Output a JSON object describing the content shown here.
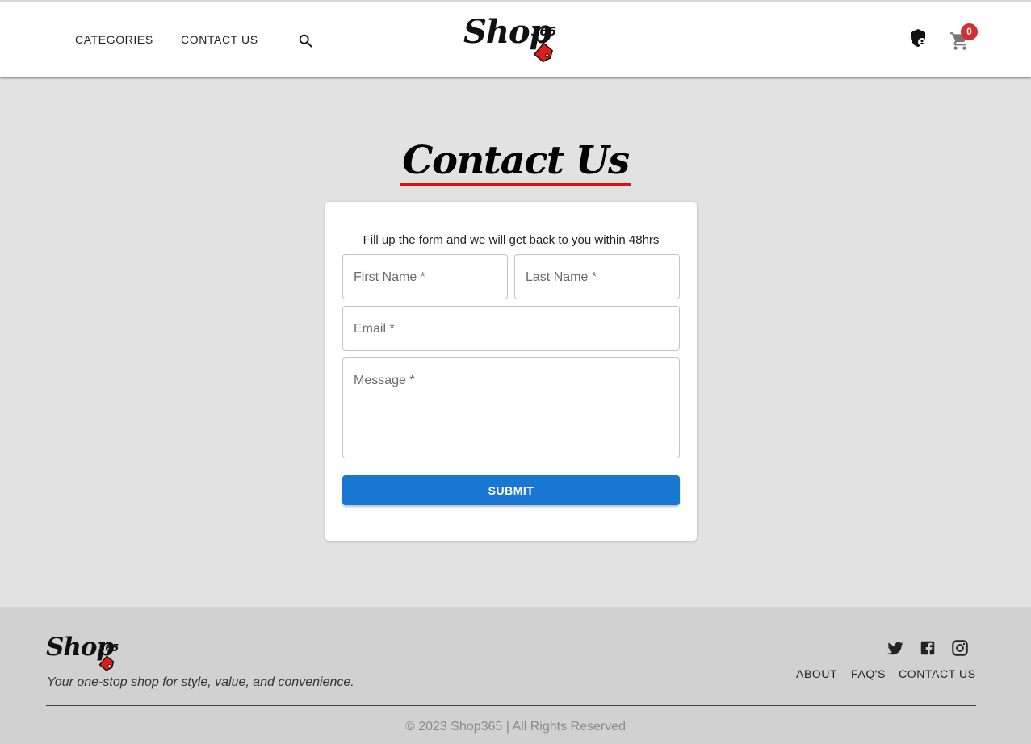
{
  "header": {
    "nav": {
      "categories": "CATEGORIES",
      "contact": "CONTACT US"
    },
    "logo": {
      "word": "Shop",
      "number": "365"
    },
    "cart_count": "0",
    "icons": {
      "search": "search-icon",
      "admin": "shield-user-icon",
      "cart": "cart-icon"
    }
  },
  "main": {
    "title": "Contact Us",
    "subtitle": "Fill up the form and we will get back to you within 48hrs",
    "form": {
      "first_name": "First Name *",
      "last_name": "Last Name *",
      "email": "Email *",
      "message": "Message *",
      "submit": "SUBMIT"
    }
  },
  "footer": {
    "logo": {
      "word": "Shop",
      "number": "365"
    },
    "tagline": "Your one-stop shop for style, value, and convenience.",
    "links": {
      "about": "ABOUT",
      "faqs": "FAQ'S",
      "contact": "CONTACT US"
    },
    "social": [
      "twitter-icon",
      "facebook-icon",
      "instagram-icon"
    ],
    "copyright": "© 2023 Shop365 | All Rights Reserved"
  },
  "colors": {
    "accent": "#1976d2",
    "badge": "#d32f2f",
    "title_underline": "#e01010",
    "background": "#e2e2e2",
    "footer": "#d1d1d1"
  }
}
